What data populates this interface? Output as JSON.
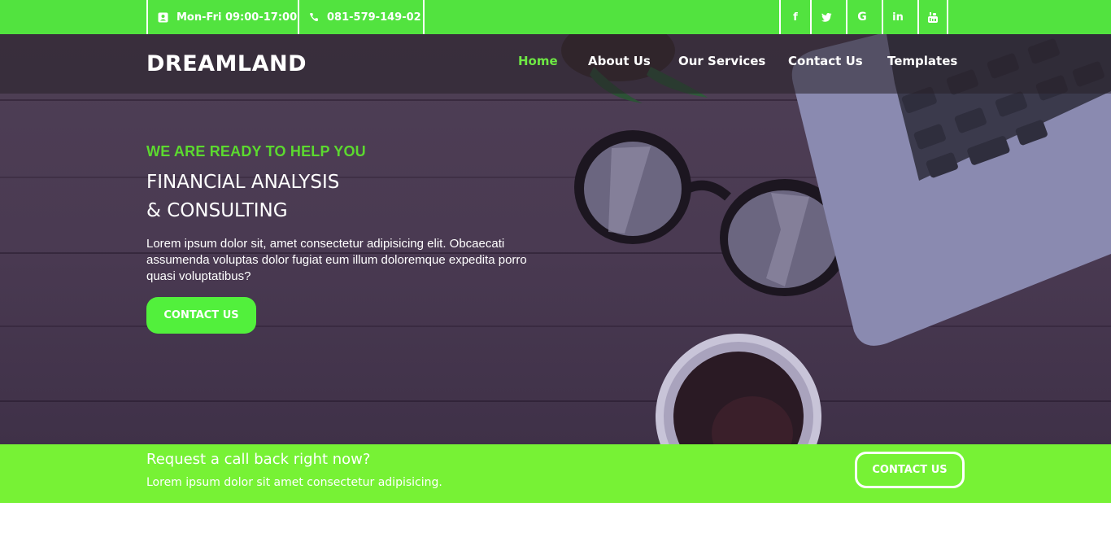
{
  "topbar": {
    "hours": "Mon-Fri 09:00-17:00",
    "phone": "081-579-149-02",
    "social": [
      {
        "icon": "facebook-icon",
        "glyph": "f"
      },
      {
        "icon": "twitter-icon",
        "glyph": ""
      },
      {
        "icon": "google-icon",
        "glyph": "G"
      },
      {
        "icon": "linkedin-icon",
        "glyph": "in"
      },
      {
        "icon": "youtube-icon",
        "glyph": ""
      }
    ],
    "color": "#52e33f"
  },
  "header": {
    "logo": "DREAMLAND",
    "nav": [
      {
        "label": "Home",
        "active": true
      },
      {
        "label": "About Us",
        "active": false
      },
      {
        "label": "Our Services",
        "active": false
      },
      {
        "label": "Contact Us",
        "active": false
      },
      {
        "label": "Templates",
        "active": false
      }
    ],
    "active_color": "#6ee844"
  },
  "hero": {
    "kicker": "WE ARE READY TO HELP YOU",
    "headline_line1": "FINANCIAL ANALYSIS",
    "headline_line2": "& CONSULTING",
    "description": "Lorem ipsum dolor sit, amet consectetur adipisicing elit. Obcaecati assumenda voluptas dolor fugiat eum illum doloremque expedita porro quasi voluptatibus?",
    "button_label": "CONTACT US",
    "accent": "#52f03c"
  },
  "cta": {
    "title": "Request a call back right now?",
    "subtitle": "Lorem ipsum dolor sit amet consectetur adipisicing.",
    "button_label": "CONTACT US",
    "color": "#77f235"
  }
}
